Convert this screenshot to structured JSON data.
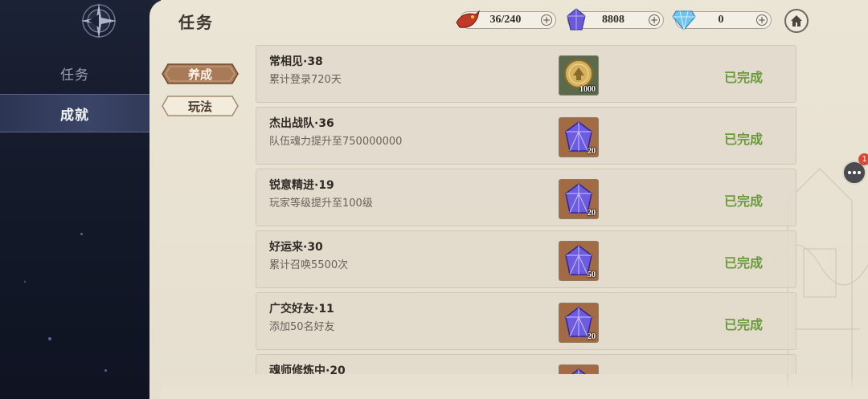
{
  "header": {
    "title": "任务"
  },
  "currencies": [
    {
      "icon": "stamina-dragon-icon",
      "value": "36/240"
    },
    {
      "icon": "purple-crystal-icon",
      "value": "8808"
    },
    {
      "icon": "blue-diamond-icon",
      "value": "0"
    }
  ],
  "sidebar": {
    "tabs": [
      {
        "label": "任务",
        "active": false
      },
      {
        "label": "成就",
        "active": true
      }
    ]
  },
  "categories": [
    {
      "label": "养成",
      "active": true
    },
    {
      "label": "玩法",
      "active": false
    }
  ],
  "tasks": [
    {
      "title": "常相见·38",
      "desc": "累计登录720天",
      "reward_icon": "gold-coin-icon",
      "reward_count": "1000",
      "status": "已完成"
    },
    {
      "title": "杰出战队·36",
      "desc": "队伍魂力提升至750000000",
      "reward_icon": "purple-crystal-icon",
      "reward_count": "20",
      "status": "已完成"
    },
    {
      "title": "锐意精进·19",
      "desc": "玩家等级提升至100级",
      "reward_icon": "purple-crystal-icon",
      "reward_count": "20",
      "status": "已完成"
    },
    {
      "title": "好运来·30",
      "desc": "累计召唤5500次",
      "reward_icon": "purple-crystal-icon",
      "reward_count": "50",
      "status": "已完成"
    },
    {
      "title": "广交好友·11",
      "desc": "添加50名好友",
      "reward_icon": "purple-crystal-icon",
      "reward_count": "20",
      "status": "已完成"
    },
    {
      "title": "魂师修炼中·20",
      "desc": "",
      "reward_icon": "purple-crystal-icon",
      "reward_count": "",
      "status": ""
    }
  ],
  "chat": {
    "badge": "1"
  },
  "colors": {
    "complete_green": "#6a9a3c",
    "active_tab": "#a97a57",
    "sidebar_bg": "#141a2a"
  }
}
